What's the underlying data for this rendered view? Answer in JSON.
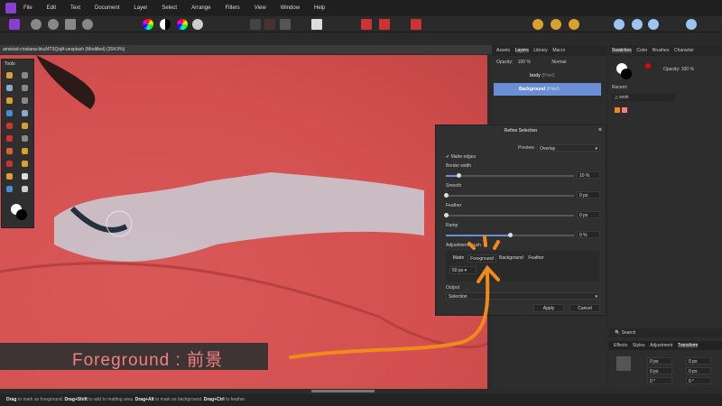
{
  "menu": [
    "File",
    "Edit",
    "Text",
    "Document",
    "Layer",
    "Select",
    "Arrange",
    "Filters",
    "View",
    "Window",
    "Help"
  ],
  "document_tab": "amistad-cristiana-bkuNTSQsjA-unsplash (Modified) (204.9%)",
  "tools_title": "Tools",
  "dialog": {
    "title": "Refine Selection",
    "preview_label": "Preview",
    "preview_value": "Overlay",
    "matte_edges": "Matte edges",
    "border_width": {
      "label": "Border width",
      "value": "10 %",
      "fraction": 0.1
    },
    "smooth": {
      "label": "Smooth",
      "value": "0 px",
      "fraction": 0
    },
    "feather": {
      "label": "Feather",
      "value": "0 px",
      "fraction": 0
    },
    "ramp": {
      "label": "Ramp",
      "value": "0 %",
      "fraction": 0.5
    },
    "adjustment_label": "Adjustment brush",
    "modes": [
      "Matte",
      "Foreground",
      "Background",
      "Feather"
    ],
    "active_mode": "Foreground",
    "brush_size": "50 px",
    "output_label": "Output",
    "output_value": "Selection",
    "apply": "Apply",
    "cancel": "Cancel"
  },
  "layers": {
    "tabs": [
      "Assets",
      "Layers",
      "Library",
      "Macro"
    ],
    "opacity_label": "Opacity:",
    "opacity": "100 %",
    "blend": "Normal",
    "items": [
      {
        "name": "body",
        "type": "(Pixel)"
      },
      {
        "name": "Background",
        "type": "(Pixel)"
      }
    ]
  },
  "swatches": {
    "tabs": [
      "Swatches",
      "Color",
      "Brushes",
      "Character"
    ],
    "opacity_label": "Opacity:",
    "opacity": "100 %",
    "recent_label": "Recent:",
    "palette": "work",
    "colors": [
      "#f08a1c",
      "#f08080"
    ]
  },
  "transform": {
    "search_placeholder": "Search",
    "tabs": [
      "Effects",
      "Styles",
      "Adjustment",
      "Transform"
    ],
    "fields": [
      "0 px",
      "0 px",
      "0 px",
      "0 px",
      "0 °",
      "0 °"
    ]
  },
  "status": [
    {
      "b": "Drag",
      "t": " to mark as foreground. "
    },
    {
      "b": "Drag+Shift",
      "t": " to add to matting area. "
    },
    {
      "b": "Drag+Alt",
      "t": " to mark as background. "
    },
    {
      "b": "Drag+Ctrl",
      "t": " to feather."
    }
  ],
  "caption": "Foreground : 前景",
  "accent": "#6b8fd4",
  "annotation_color": "#f08a1c"
}
